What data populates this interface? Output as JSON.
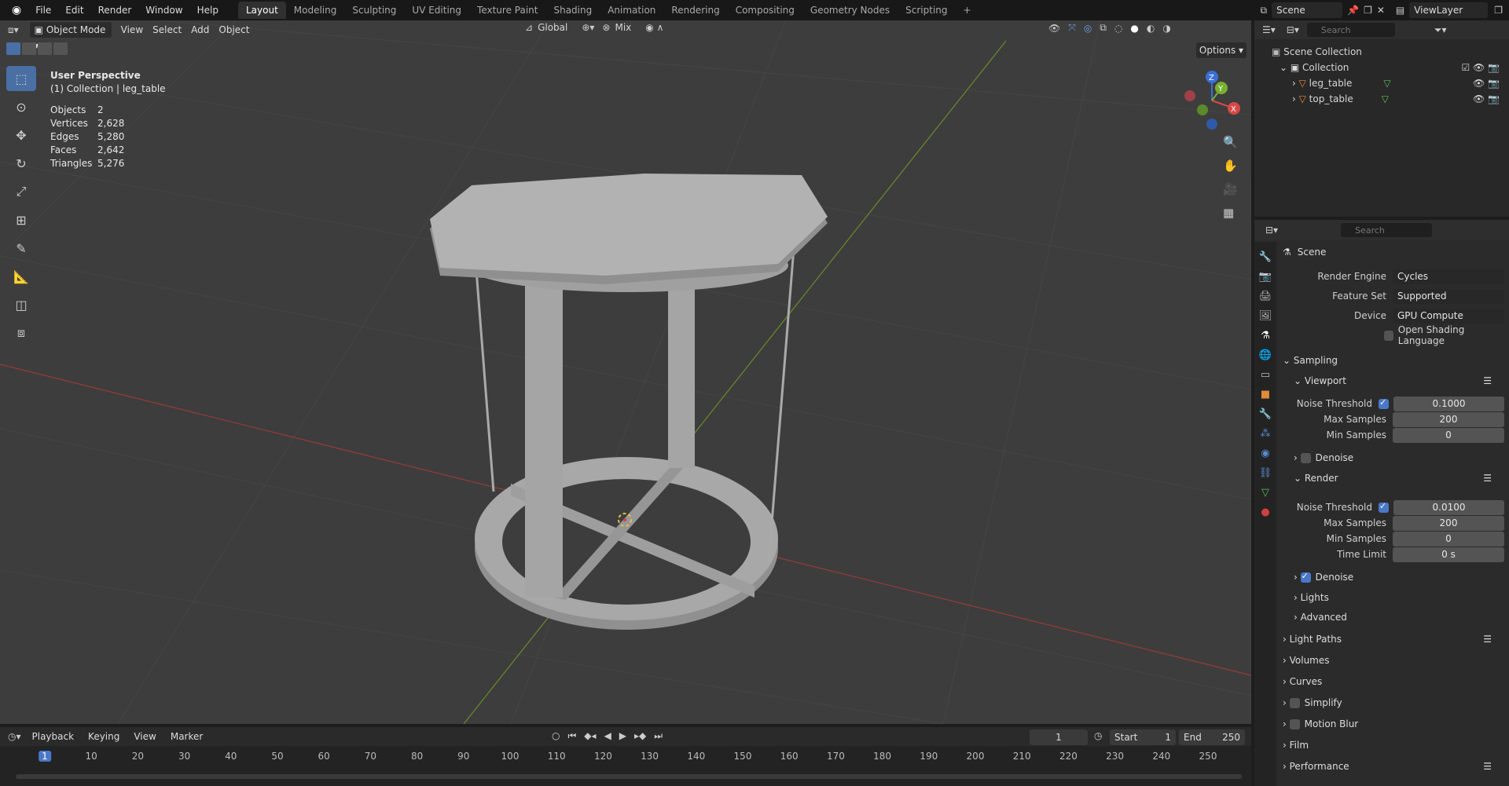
{
  "menu": [
    "File",
    "Edit",
    "Render",
    "Window",
    "Help"
  ],
  "workspaces": [
    {
      "label": "Layout",
      "active": true
    },
    {
      "label": "Modeling"
    },
    {
      "label": "Sculpting"
    },
    {
      "label": "UV Editing"
    },
    {
      "label": "Texture Paint"
    },
    {
      "label": "Shading"
    },
    {
      "label": "Animation"
    },
    {
      "label": "Rendering"
    },
    {
      "label": "Compositing"
    },
    {
      "label": "Geometry Nodes"
    },
    {
      "label": "Scripting"
    }
  ],
  "scene_name": "Scene",
  "view_layer": "ViewLayer",
  "viewport": {
    "mode": "Object Mode",
    "menus": [
      "View",
      "Select",
      "Add",
      "Object"
    ],
    "transform_orientation": "Global",
    "snap_mode": "Mix",
    "options_label": "Options",
    "perspective_label": "User Perspective",
    "collection_label": "(1) Collection | leg_table",
    "stats": [
      {
        "k": "Objects",
        "v": "2"
      },
      {
        "k": "Vertices",
        "v": "2,628"
      },
      {
        "k": "Edges",
        "v": "5,280"
      },
      {
        "k": "Faces",
        "v": "2,642"
      },
      {
        "k": "Triangles",
        "v": "5,276"
      }
    ],
    "gizmo_axes": [
      "Z",
      "Y",
      "X"
    ]
  },
  "outliner": {
    "search_placeholder": "Search",
    "root": "Scene Collection",
    "collection": "Collection",
    "objects": [
      "leg_table",
      "top_table"
    ]
  },
  "properties": {
    "search_placeholder": "Search",
    "context": "Scene",
    "render_engine_label": "Render Engine",
    "render_engine": "Cycles",
    "feature_set_label": "Feature Set",
    "feature_set": "Supported",
    "device_label": "Device",
    "device": "GPU Compute",
    "osl_label": "Open Shading Language",
    "sampling": "Sampling",
    "viewport_section": "Viewport",
    "noise_threshold_label": "Noise Threshold",
    "max_samples_label": "Max Samples",
    "min_samples_label": "Min Samples",
    "time_limit_label": "Time Limit",
    "vp_noise_threshold": "0.1000",
    "vp_max_samples": "200",
    "vp_min_samples": "0",
    "denoise_label": "Denoise",
    "render_section": "Render",
    "r_noise_threshold": "0.0100",
    "r_max_samples": "200",
    "r_min_samples": "0",
    "r_time_limit": "0 s",
    "lights": "Lights",
    "advanced": "Advanced",
    "panels": [
      "Light Paths",
      "Volumes",
      "Curves",
      "Simplify",
      "Motion Blur",
      "Film",
      "Performance"
    ]
  },
  "timeline": {
    "menus": [
      "Playback",
      "Keying",
      "View",
      "Marker"
    ],
    "current_frame": "1",
    "start_label": "Start",
    "start": "1",
    "end_label": "End",
    "end": "250",
    "ticks": [
      "1",
      "10",
      "20",
      "30",
      "40",
      "50",
      "60",
      "70",
      "80",
      "90",
      "100",
      "110",
      "120",
      "130",
      "140",
      "150",
      "160",
      "170",
      "180",
      "190",
      "200",
      "210",
      "220",
      "230",
      "240",
      "250"
    ]
  }
}
